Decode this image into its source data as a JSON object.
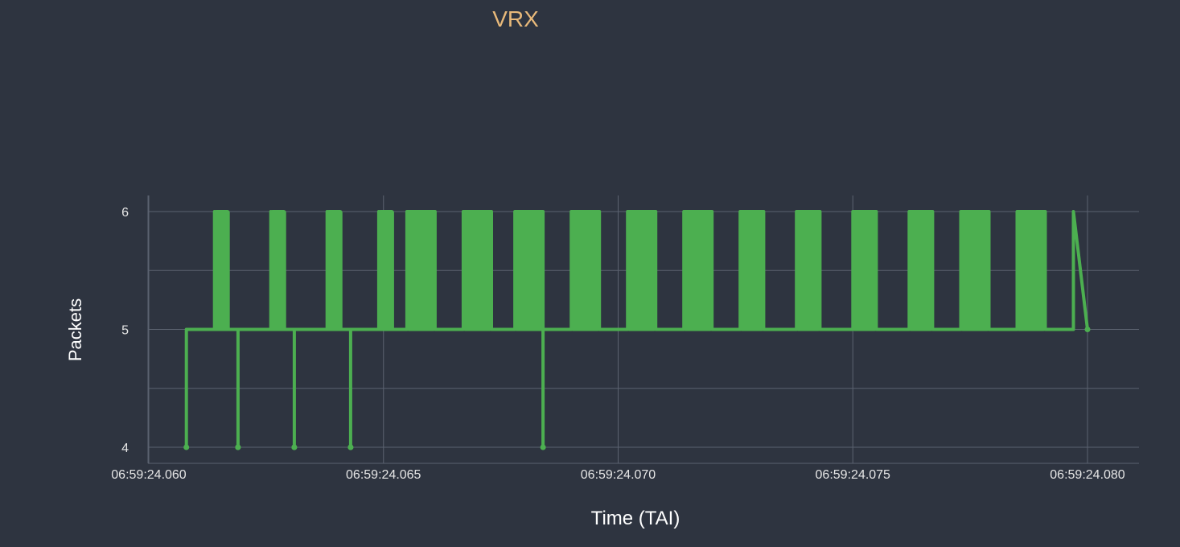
{
  "chart_data": {
    "type": "line",
    "title": "VRX",
    "xlabel": "Time (TAI)",
    "ylabel": "Packets",
    "x_unit": "seconds past 06:59:24",
    "x_ticks": [
      {
        "value": 24.06,
        "label": "06:59:24.060"
      },
      {
        "value": 24.065,
        "label": "06:59:24.065"
      },
      {
        "value": 24.07,
        "label": "06:59:24.070"
      },
      {
        "value": 24.075,
        "label": "06:59:24.075"
      },
      {
        "value": 24.08,
        "label": "06:59:24.080"
      }
    ],
    "y_ticks": [
      {
        "value": 4,
        "label": "4"
      },
      {
        "value": 5,
        "label": "5"
      },
      {
        "value": 6,
        "label": "6"
      }
    ],
    "xlim": [
      24.06,
      24.0811
    ],
    "ylim": [
      3.86,
      6.14
    ],
    "grid": true,
    "series": [
      {
        "color": "#4caf50",
        "x": [
          24.0608,
          24.0608,
          24.0609,
          24.0609,
          24.0614,
          24.0614,
          24.0614,
          24.0614,
          24.0619,
          24.0619,
          24.0619,
          24.0619,
          24.0626,
          24.0626,
          24.0626,
          24.0626,
          24.0631,
          24.0631,
          24.0631,
          24.0631,
          24.0638,
          24.0638,
          24.0638,
          24.0638,
          24.0643,
          24.0643,
          24.0643,
          24.0643,
          24.0649,
          24.0649,
          24.0649,
          24.0649,
          24.0655,
          24.0655,
          24.0661,
          24.0661,
          24.0667,
          24.0667,
          24.0673,
          24.0673,
          24.0678,
          24.0678,
          24.0684,
          24.0684,
          24.0684,
          24.0684,
          24.069,
          24.069,
          24.0696,
          24.0696,
          24.0702,
          24.0702,
          24.0708,
          24.0708,
          24.0714,
          24.0714,
          24.072,
          24.072,
          24.0726,
          24.0726,
          24.0731,
          24.0731,
          24.0738,
          24.0738,
          24.0743,
          24.0743,
          24.075,
          24.075,
          24.0755,
          24.0755,
          24.0762,
          24.0762,
          24.0767,
          24.0767,
          24.0773,
          24.0773,
          24.0779,
          24.0779,
          24.0785,
          24.0785,
          24.0791,
          24.0791,
          24.0797,
          24.0797,
          24.08
        ],
        "y": [
          4,
          5,
          5,
          5,
          5,
          6,
          6,
          5,
          5,
          4,
          4,
          5,
          5,
          6,
          6,
          5,
          5,
          4,
          4,
          5,
          5,
          6,
          6,
          5,
          5,
          4,
          4,
          5,
          5,
          6,
          6,
          5,
          5,
          6,
          6,
          5,
          5,
          6,
          6,
          5,
          5,
          6,
          6,
          5,
          4,
          5,
          5,
          6,
          6,
          5,
          5,
          6,
          6,
          5,
          5,
          6,
          6,
          5,
          5,
          6,
          6,
          5,
          5,
          6,
          6,
          5,
          5,
          6,
          6,
          5,
          5,
          6,
          6,
          5,
          5,
          6,
          6,
          5,
          5,
          6,
          6,
          5,
          5,
          6,
          5
        ]
      }
    ]
  }
}
